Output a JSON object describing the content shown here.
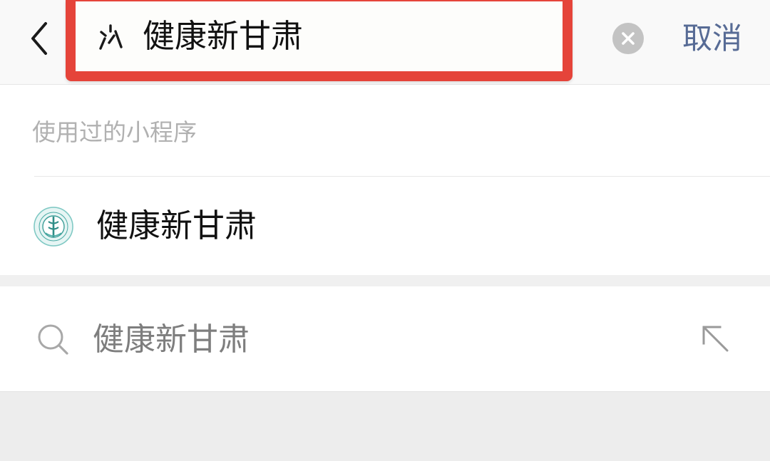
{
  "header": {
    "back_icon": "chevron-left-icon",
    "search_query": "健康新甘肃",
    "mini_program_icon": "mini-program-icon",
    "clear_icon": "clear-circle-icon",
    "cancel_label": "取消",
    "highlight_color": "#e5443a",
    "accent_color": "#576b95"
  },
  "used_section": {
    "title": "使用过的小程序",
    "items": [
      {
        "name": "健康新甘肃",
        "logo": "health-emblem-logo"
      }
    ]
  },
  "suggestion": {
    "icon": "search-icon",
    "text": "健康新甘肃",
    "fill_icon": "arrow-up-left-icon"
  }
}
